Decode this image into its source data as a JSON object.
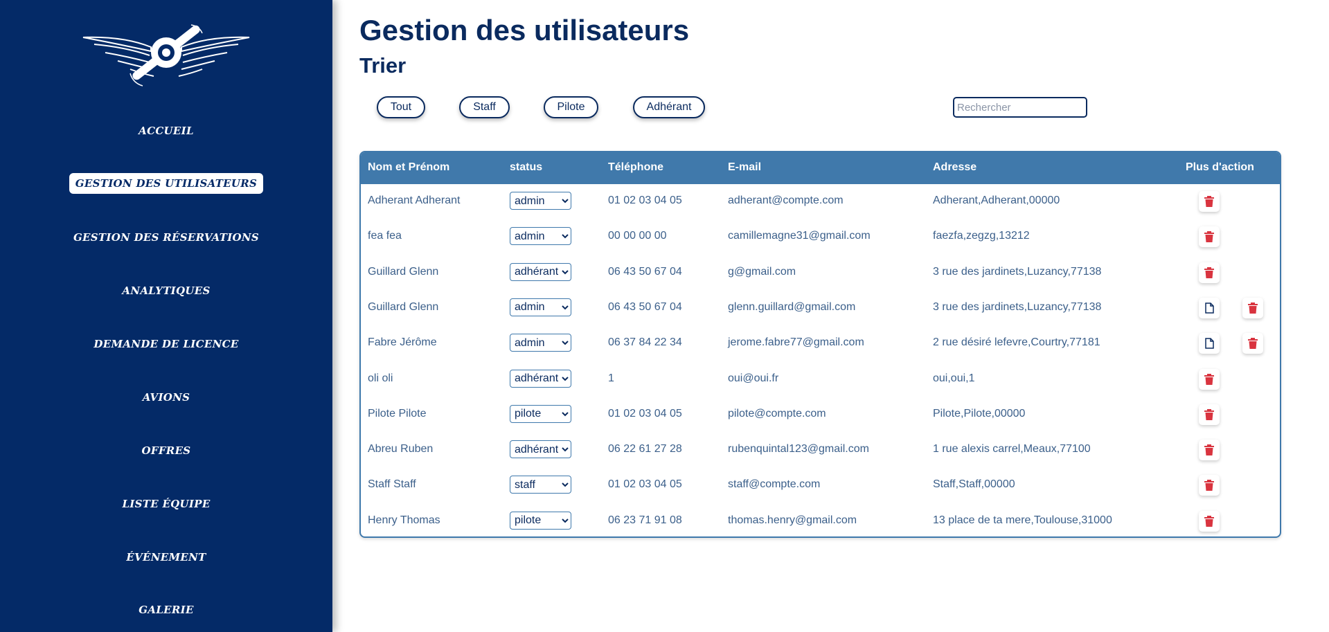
{
  "sidebar": {
    "items": [
      {
        "label": "Accueil"
      },
      {
        "label": "Gestion des utilisateurs",
        "active": true
      },
      {
        "label": "Gestion des réservations"
      },
      {
        "label": "Analytiques"
      },
      {
        "label": "Demande de licence"
      },
      {
        "label": "Avions"
      },
      {
        "label": "Offres"
      },
      {
        "label": "Liste équipe"
      },
      {
        "label": "Événement"
      },
      {
        "label": "Galerie"
      }
    ]
  },
  "header": {
    "title": "Gestion des utilisateurs",
    "sort_title": "Trier"
  },
  "filters": [
    "Tout",
    "Staff",
    "Pilote",
    "Adhérant"
  ],
  "search": {
    "placeholder": "Rechercher"
  },
  "table": {
    "columns": [
      "Nom et Prénom",
      "status",
      "Téléphone",
      "E-mail",
      "Adresse",
      "Plus d'action"
    ],
    "status_options": [
      "admin",
      "adhérant",
      "pilote",
      "staff"
    ],
    "rows": [
      {
        "name": "Adherant Adherant",
        "status": "admin",
        "phone": "01 02 03 04 05",
        "email": "adherant@compte.com",
        "address": "Adherant,Adherant,00000",
        "has_document": false
      },
      {
        "name": "fea fea",
        "status": "admin",
        "phone": "00 00 00 00",
        "email": "camillemagne31@gmail.com",
        "address": "faezfa,zegzg,13212",
        "has_document": false
      },
      {
        "name": "Guillard Glenn",
        "status": "adhérant",
        "phone": "06 43 50 67 04",
        "email": "g@gmail.com",
        "address": "3 rue des jardinets,Luzancy,77138",
        "has_document": false
      },
      {
        "name": "Guillard Glenn",
        "status": "admin",
        "phone": "06 43 50 67 04",
        "email": "glenn.guillard@gmail.com",
        "address": "3 rue des jardinets,Luzancy,77138",
        "has_document": true
      },
      {
        "name": "Fabre Jérôme",
        "status": "admin",
        "phone": "06 37 84 22 34",
        "email": "jerome.fabre77@gmail.com",
        "address": "2 rue désiré lefevre,Courtry,77181",
        "has_document": true
      },
      {
        "name": "oli oli",
        "status": "adhérant",
        "phone": "1",
        "email": "oui@oui.fr",
        "address": "oui,oui,1",
        "has_document": false
      },
      {
        "name": "Pilote Pilote",
        "status": "pilote",
        "phone": "01 02 03 04 05",
        "email": "pilote@compte.com",
        "address": "Pilote,Pilote,00000",
        "has_document": false
      },
      {
        "name": "Abreu Ruben",
        "status": "adhérant",
        "phone": "06 22 61 27 28",
        "email": "rubenquintal123@gmail.com",
        "address": "1 rue alexis carrel,Meaux,77100",
        "has_document": false
      },
      {
        "name": "Staff Staff",
        "status": "staff",
        "phone": "01 02 03 04 05",
        "email": "staff@compte.com",
        "address": "Staff,Staff,00000",
        "has_document": false
      },
      {
        "name": "Henry Thomas",
        "status": "pilote",
        "phone": "06 23 71 91 08",
        "email": "thomas.henry@gmail.com",
        "address": "13 place de ta mere,Toulouse,31000",
        "has_document": false
      }
    ]
  },
  "colors": {
    "sidebar_bg": "#042a67",
    "header_bg": "#4079ab",
    "title": "#0a2a5e",
    "text": "#3b5f8a",
    "delete": "#d9343f"
  },
  "icons": {
    "logo": "winged-propeller-logo",
    "delete": "trash-icon",
    "document": "document-icon"
  }
}
